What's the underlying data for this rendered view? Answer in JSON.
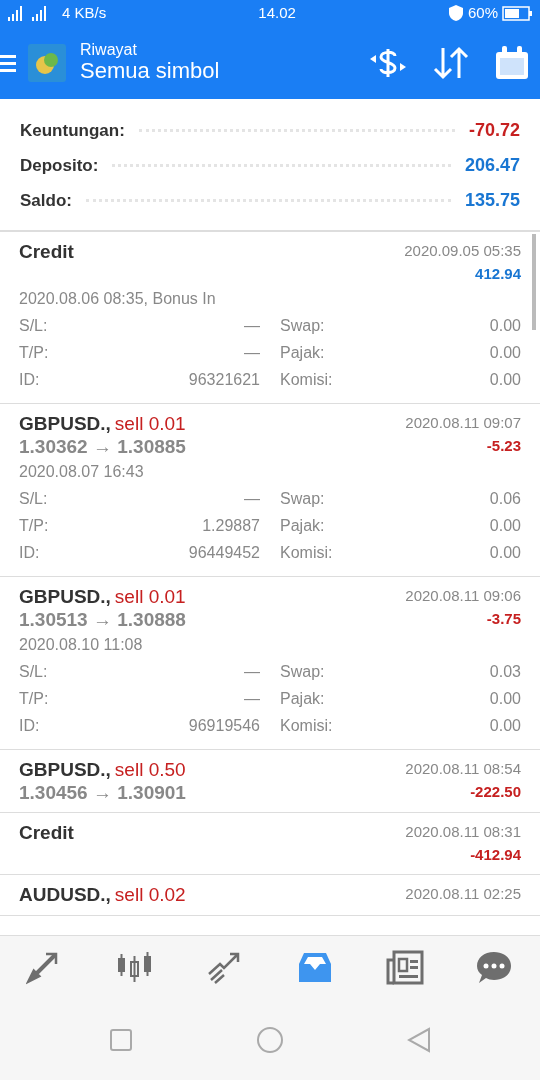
{
  "status_bar": {
    "network": "4 KB/s",
    "time": "14.02",
    "battery": "60%"
  },
  "header": {
    "subtitle": "Riwayat",
    "title": "Semua simbol"
  },
  "summary": [
    {
      "label": "Keuntungan:",
      "value": "-70.72",
      "loss": true
    },
    {
      "label": "Deposito:",
      "value": "206.47",
      "loss": false
    },
    {
      "label": "Saldo:",
      "value": "135.75",
      "loss": false
    }
  ],
  "deals": [
    {
      "kind": "credit",
      "symbol": "Credit",
      "time": "2020.09.05 05:35",
      "profit": "412.94",
      "loss": false,
      "expanded": true,
      "open_info": "2020.08.06 08:35, Bonus In",
      "details": [
        [
          "S/L:",
          "—",
          "Swap:",
          "0.00"
        ],
        [
          "T/P:",
          "—",
          "Pajak:",
          "0.00"
        ],
        [
          "ID:",
          "96321621",
          "Komisi:",
          "0.00"
        ]
      ]
    },
    {
      "kind": "trade",
      "symbol": "GBPUSD.,",
      "side": "sell 0.01",
      "prices": "1.30362 → 1.30885",
      "time": "2020.08.11 09:07",
      "profit": "-5.23",
      "loss": true,
      "expanded": true,
      "open_info": "2020.08.07 16:43",
      "details": [
        [
          "S/L:",
          "—",
          "Swap:",
          "0.06"
        ],
        [
          "T/P:",
          "1.29887",
          "Pajak:",
          "0.00"
        ],
        [
          "ID:",
          "96449452",
          "Komisi:",
          "0.00"
        ]
      ]
    },
    {
      "kind": "trade",
      "symbol": "GBPUSD.,",
      "side": "sell 0.01",
      "prices": "1.30513 → 1.30888",
      "time": "2020.08.11 09:06",
      "profit": "-3.75",
      "loss": true,
      "expanded": true,
      "open_info": "2020.08.10 11:08",
      "details": [
        [
          "S/L:",
          "—",
          "Swap:",
          "0.03"
        ],
        [
          "T/P:",
          "—",
          "Pajak:",
          "0.00"
        ],
        [
          "ID:",
          "96919546",
          "Komisi:",
          "0.00"
        ]
      ]
    },
    {
      "kind": "trade",
      "symbol": "GBPUSD.,",
      "side": "sell 0.50",
      "prices": "1.30456 → 1.30901",
      "time": "2020.08.11 08:54",
      "profit": "-222.50",
      "loss": true,
      "expanded": false
    },
    {
      "kind": "credit",
      "symbol": "Credit",
      "time": "2020.08.11 08:31",
      "profit": "-412.94",
      "loss": true,
      "expanded": false
    },
    {
      "kind": "trade",
      "symbol": "AUDUSD.,",
      "side": "sell 0.02",
      "time": "2020.08.11 02:25",
      "expanded": false
    }
  ],
  "bottom_nav": [
    {
      "selected": false
    },
    {
      "selected": false
    },
    {
      "selected": false
    },
    {
      "selected": true
    },
    {
      "selected": false
    },
    {
      "selected": false
    }
  ]
}
